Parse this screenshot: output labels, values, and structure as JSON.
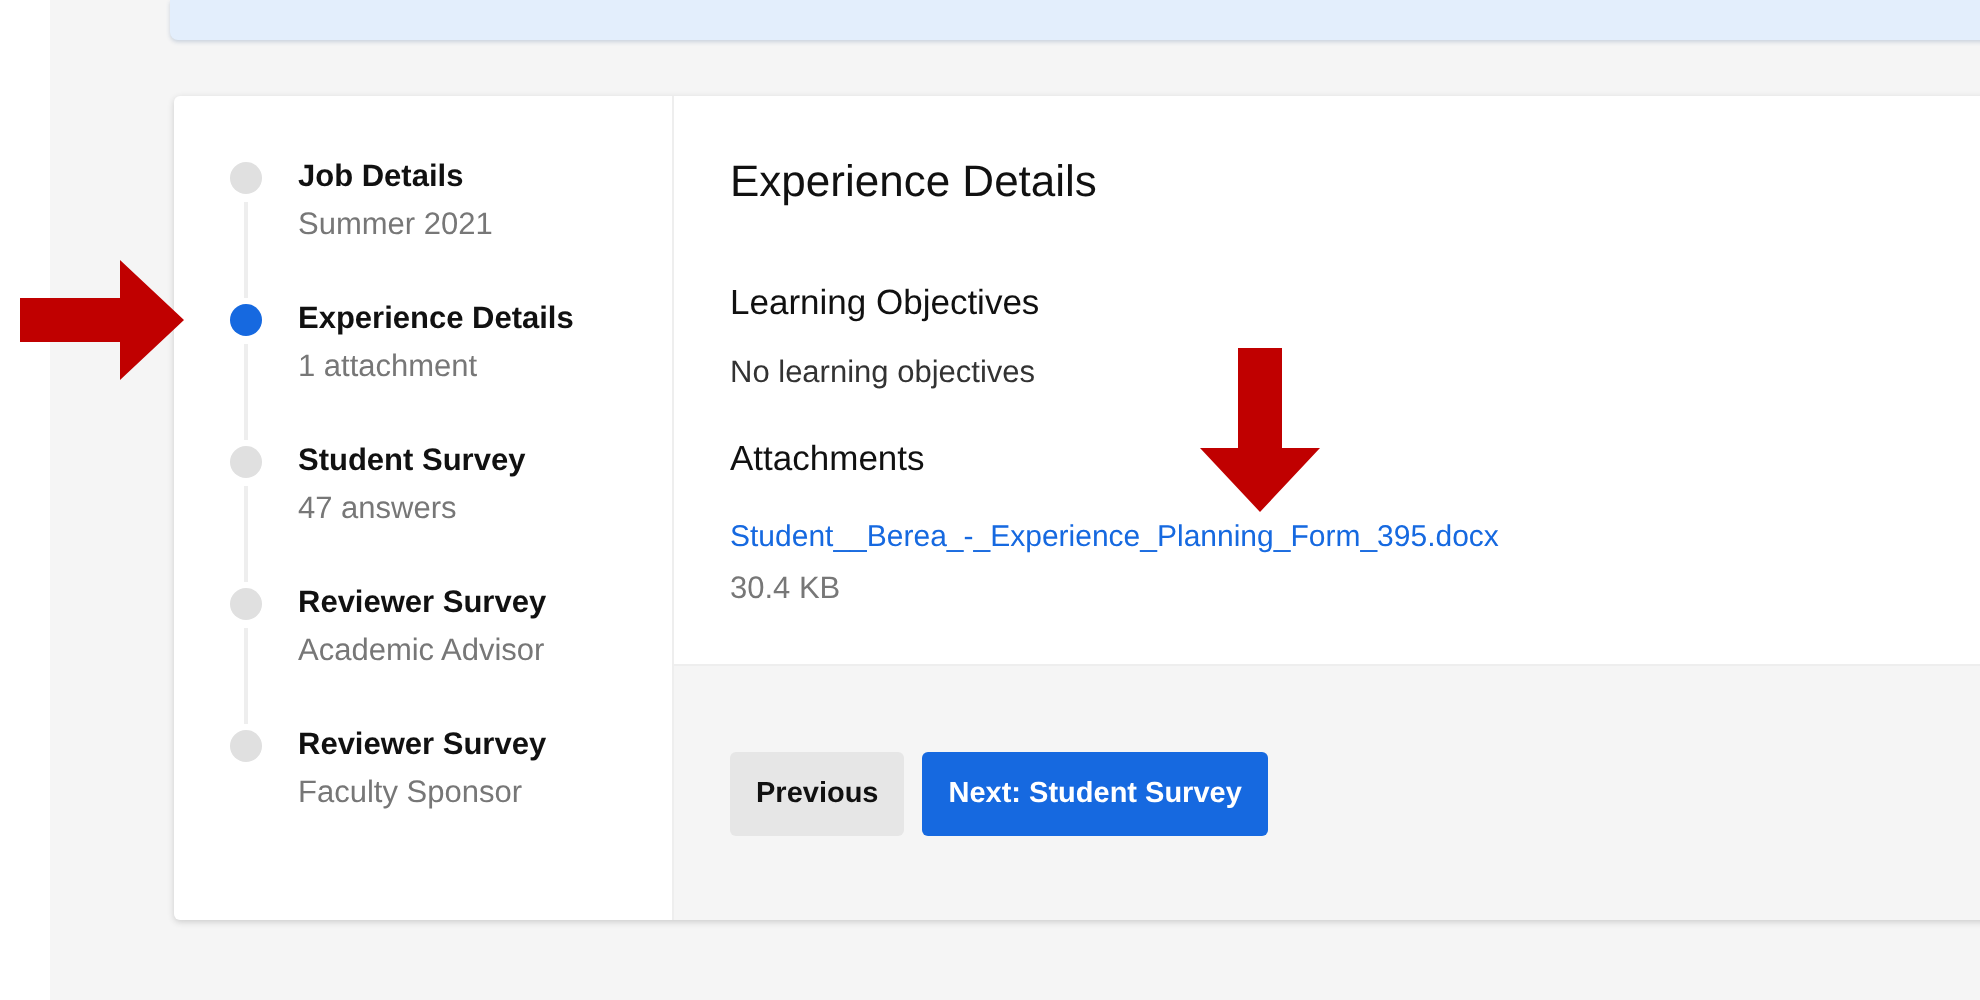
{
  "steps": [
    {
      "title": "Job Details",
      "subtitle": "Summer 2021",
      "selected": false
    },
    {
      "title": "Experience Details",
      "subtitle": "1 attachment",
      "selected": true
    },
    {
      "title": "Student Survey",
      "subtitle": "47 answers",
      "selected": false
    },
    {
      "title": "Reviewer Survey",
      "subtitle": "Academic Advisor",
      "selected": false
    },
    {
      "title": "Reviewer Survey",
      "subtitle": "Faculty Sponsor",
      "selected": false
    }
  ],
  "content": {
    "title": "Experience Details",
    "sections": [
      {
        "heading": "Learning Objectives",
        "kind": "text",
        "text": "No learning objectives"
      },
      {
        "heading": "Attachments",
        "kind": "file",
        "link": "Student__Berea_-_Experience_Planning_Form_395.docx",
        "size": "30.4 KB"
      }
    ]
  },
  "buttons": [
    {
      "label": "Previous",
      "kind": "secondary"
    },
    {
      "label": "Next: Student Survey",
      "kind": "primary"
    }
  ],
  "annotations": [
    {
      "kind": "arrow-right"
    },
    {
      "kind": "arrow-down"
    }
  ]
}
